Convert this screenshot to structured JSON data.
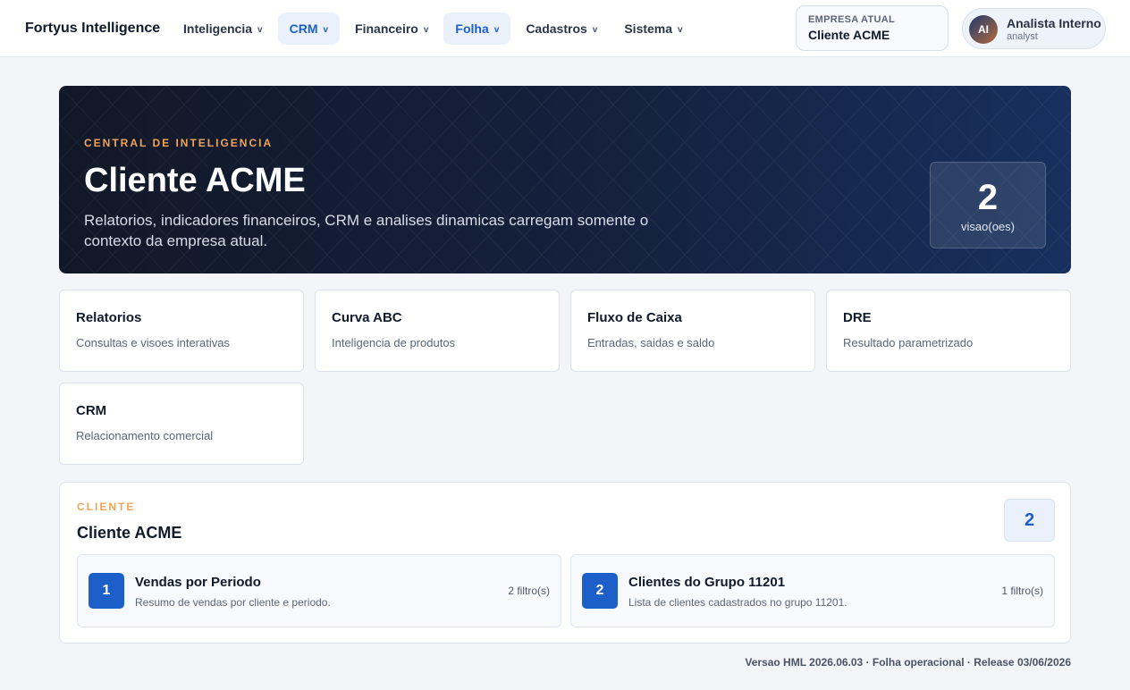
{
  "brand": "Fortyus Intelligence",
  "nav": [
    {
      "label": "Inteligencia",
      "active": false
    },
    {
      "label": "CRM",
      "active": true
    },
    {
      "label": "Financeiro",
      "active": false
    },
    {
      "label": "Folha",
      "active": true
    },
    {
      "label": "Cadastros",
      "active": false
    },
    {
      "label": "Sistema",
      "active": false
    }
  ],
  "nav_chevron": "v",
  "company": {
    "label": "EMPRESA ATUAL",
    "value": "Cliente ACME"
  },
  "user": {
    "initials": "AI",
    "name": "Analista Interno",
    "role": "analyst"
  },
  "hero": {
    "eyebrow": "CENTRAL DE INTELIGENCIA",
    "title": "Cliente ACME",
    "description": "Relatorios, indicadores financeiros, CRM e analises dinamicas carregam somente o contexto da empresa atual.",
    "stat_value": "2",
    "stat_label": "visao(oes)"
  },
  "modules": [
    {
      "title": "Relatorios",
      "subtitle": "Consultas e visoes interativas"
    },
    {
      "title": "Curva ABC",
      "subtitle": "Inteligencia de produtos"
    },
    {
      "title": "Fluxo de Caixa",
      "subtitle": "Entradas, saidas e saldo"
    },
    {
      "title": "DRE",
      "subtitle": "Resultado parametrizado"
    },
    {
      "title": "CRM",
      "subtitle": "Relacionamento comercial"
    }
  ],
  "client_panel": {
    "eyebrow": "CLIENTE",
    "title": "Cliente ACME",
    "count": "2",
    "views": [
      {
        "number": "1",
        "title": "Vendas por Periodo",
        "description": "Resumo de vendas por cliente e periodo.",
        "filters": "2 filtro(s)"
      },
      {
        "number": "2",
        "title": "Clientes do Grupo 11201",
        "description": "Lista de clientes cadastrados no grupo 11201.",
        "filters": "1 filtro(s)"
      }
    ]
  },
  "footer": "Versao HML 2026.06.03 · Folha operacional · Release 03/06/2026",
  "colors": {
    "accent": "#1d5fc9",
    "eyebrow": "#f0a45a",
    "hero_bg": "#15213e"
  }
}
